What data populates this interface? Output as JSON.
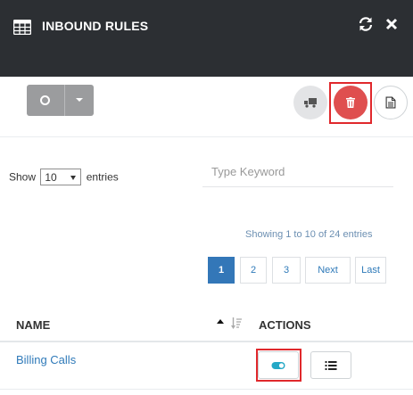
{
  "header": {
    "title": "INBOUND RULES",
    "icon": "grid-icon",
    "refresh_icon": "refresh-icon",
    "close_icon": "close-icon",
    "background": "#2c2f33"
  },
  "toolbar": {
    "split_button_icon": "circle-icon",
    "truck_icon": "truck-icon",
    "delete_icon": "trash-icon",
    "document_icon": "document-icon",
    "delete_color": "#df4f4f"
  },
  "table_controls": {
    "show_label": "Show",
    "entries_selected": "10",
    "entries_label": "entries",
    "search_placeholder": "Type Keyword",
    "info": "Showing 1 to 10 of 24 entries"
  },
  "pagination": {
    "pages": [
      "1",
      "2",
      "3"
    ],
    "active_page": "1",
    "next": "Next",
    "last": "Last",
    "accent": "#3377b8"
  },
  "table": {
    "columns": [
      "NAME",
      "ACTIONS"
    ],
    "rows": [
      {
        "name": "Billing Calls",
        "toggle_icon": "toggle-on-icon",
        "list_icon": "list-icon"
      }
    ]
  }
}
